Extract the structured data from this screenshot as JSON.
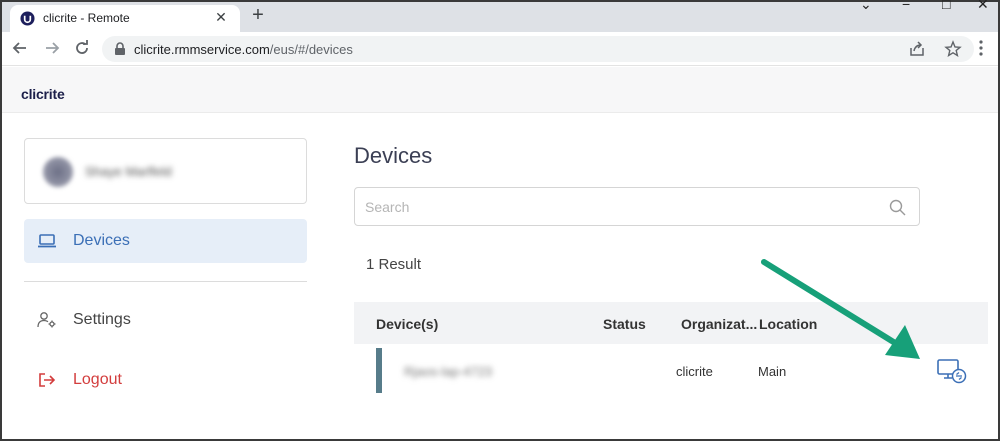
{
  "browser": {
    "tab_title": "clicrite - Remote",
    "tab_close": "✕",
    "new_tab": "+",
    "url_host": "clicrite.rmmservice.com",
    "url_path": "/eus/#/devices",
    "icons": [
      "back-icon",
      "forward-icon",
      "reload-icon",
      "lock-icon",
      "share-icon",
      "star-icon",
      "menu-icon"
    ]
  },
  "app": {
    "brand": "clicrite"
  },
  "sidebar": {
    "user_name": "Shaye Marlfeld",
    "items": [
      {
        "label": "Devices",
        "icon": "laptop-icon",
        "active": true
      },
      {
        "label": "Settings",
        "icon": "user-settings-icon",
        "active": false
      },
      {
        "label": "Logout",
        "icon": "logout-icon",
        "active": false
      }
    ]
  },
  "main": {
    "title": "Devices",
    "search_placeholder": "Search",
    "result_count": "1 Result",
    "columns": [
      "Device(s)",
      "Status",
      "Organizat...",
      "Location"
    ],
    "rows": [
      {
        "device": "Rjaos-lap-4723",
        "status": "",
        "organization": "clicrite",
        "location": "Main",
        "action_icon": "remote-connect-icon"
      }
    ]
  },
  "colors": {
    "accent": "#3b6fb6",
    "logout": "#d33d3d",
    "arrow": "#17a079",
    "row_bar": "#577c8a"
  }
}
